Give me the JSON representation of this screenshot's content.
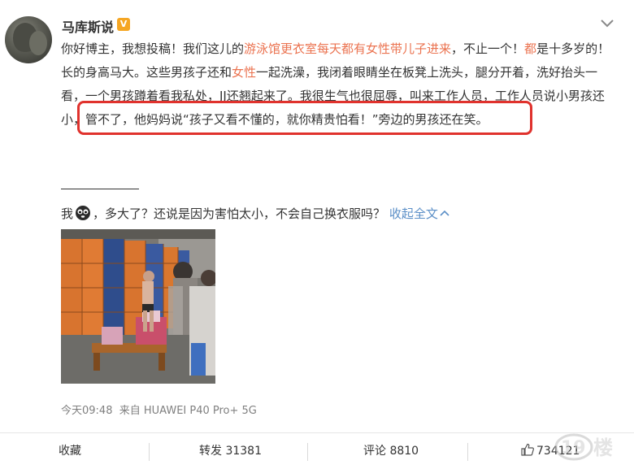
{
  "author": {
    "name": "马库斯说",
    "verified_badge": "V"
  },
  "post": {
    "t1": "你好博主，我想投稿！我们这儿的",
    "h1": "游泳馆更衣室每天都有女性带儿子进来",
    "t2": "，不止一个！",
    "h2": "都",
    "t3": "是十多岁的！长的身高马大。这些男孩子还和",
    "h3": "女性",
    "t4": "一起洗澡，我闭着眼睛坐在板凳上洗头，腿分开着，洗好抬头一看，一个男孩蹲着看我私处，JJ还翘起来了。我很生气也很屈辱，叫来工作人员，工作人员说小男孩还小，管不了，他妈妈说“孩子又看不懂的，就你精贵怕看！”旁边的男孩还在笑。"
  },
  "reply": {
    "prefix": "我",
    "emoji_icon": "black-face-emoji-icon",
    "text": "，多大了？还说是因为害怕太小，不会自己换衣服吗？",
    "collapse_label": "收起全文",
    "collapse_icon": "chevron-up-icon"
  },
  "meta": {
    "time": "今天09:48",
    "source": "来自 HUAWEI P40 Pro+ 5G"
  },
  "actions": {
    "favorite": "收藏",
    "repost": "转发 31381",
    "comment": "评论 8810",
    "like_icon": "thumbs-up-icon",
    "like": "734121"
  },
  "colors": {
    "highlight": "#eb7350",
    "link": "#5b8fc7",
    "annotation_box": "#e0322d",
    "badge": "#f5a623"
  }
}
